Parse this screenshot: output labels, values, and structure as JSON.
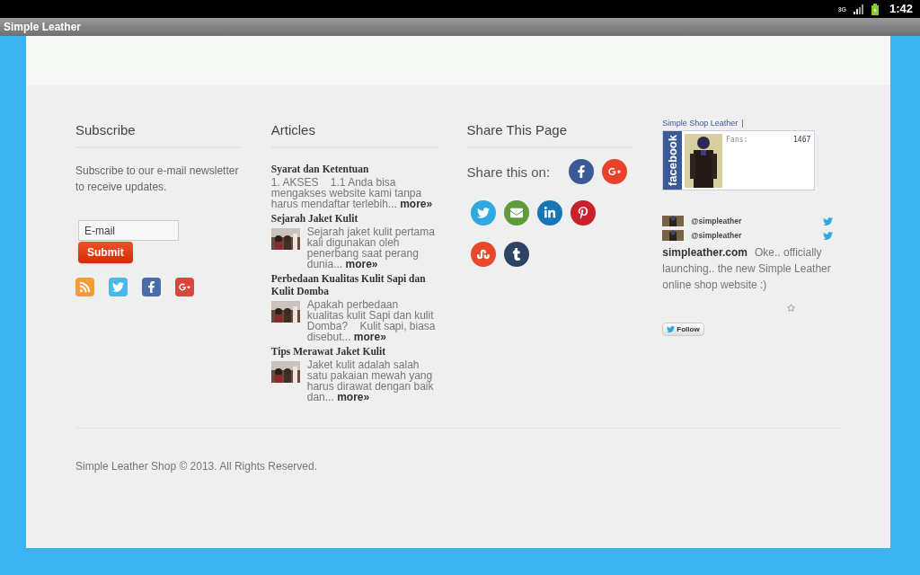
{
  "status_bar": {
    "network": "3G",
    "time": "1:42"
  },
  "app_bar": {
    "title": "Simple Leather"
  },
  "subscribe": {
    "heading": "Subscribe",
    "text": "Subscribe to our e-mail newsletter to receive updates.",
    "email_field": {
      "placeholder": "E-mail"
    },
    "submit": "Submit",
    "social_icons": [
      {
        "kind": "rss"
      },
      {
        "kind": "twitter"
      },
      {
        "kind": "facebook"
      },
      {
        "kind": "google"
      }
    ]
  },
  "articles": {
    "heading": "Articles",
    "items": [
      {
        "title": "Syarat dan Ketentuan",
        "excerpt": "1. AKSES    1.1 Anda bisa mengakses website kami tanpa harus mendaftar terlebih...",
        "more": "more»"
      },
      {
        "title": "Sejarah Jaket Kulit",
        "excerpt": "Sejarah jaket kulit pertama kali digunakan oleh penerbang saat perang dunia...",
        "more": "more»"
      },
      {
        "title": "Perbedaan Kualitas Kulit Sapi dan Kulit Domba",
        "excerpt": "Apakah perbedaan kualitas kulit Sapi dan kulit Domba?    Kulit sapi, biasa disebut...",
        "more": "more»"
      },
      {
        "title": "Tips Merawat Jaket Kulit",
        "excerpt": "Jaket kulit adalah salah satu pakaian mewah yang harus dirawat dengan baik dan...",
        "more": "more»"
      }
    ]
  },
  "share": {
    "heading": "Share This Page",
    "prompt": "Share this on:",
    "buttons": [
      {
        "kind": "facebook",
        "color": "#3b5998"
      },
      {
        "kind": "google",
        "color": "#e8412c"
      },
      {
        "kind": "twitter",
        "color": "#2fa9e0"
      },
      {
        "kind": "email",
        "color": "#5e9c3a"
      },
      {
        "kind": "linkedin",
        "color": "#1a75b4"
      },
      {
        "kind": "pinterest",
        "color": "#c8202c"
      },
      {
        "kind": "stumbleupon",
        "color": "#e8492a"
      },
      {
        "kind": "tumblr",
        "color": "#2d4363"
      }
    ]
  },
  "fb_widget": {
    "page_link": "Simple Shop Leather",
    "separator": "|",
    "logo_text": "facebook",
    "fans_label": "Fans:",
    "fans": "1467"
  },
  "twitter_widget": {
    "tweets": [
      {
        "handle": "@simpleather"
      },
      {
        "handle": "@simpleather",
        "site": "simpleather.com",
        "text": "Oke.. officially launching.. the new Simple Leather online shop website :)"
      }
    ],
    "follow": "Follow"
  },
  "footer": {
    "copyright": "Simple Leather Shop © 2013. All Rights Reserved."
  }
}
